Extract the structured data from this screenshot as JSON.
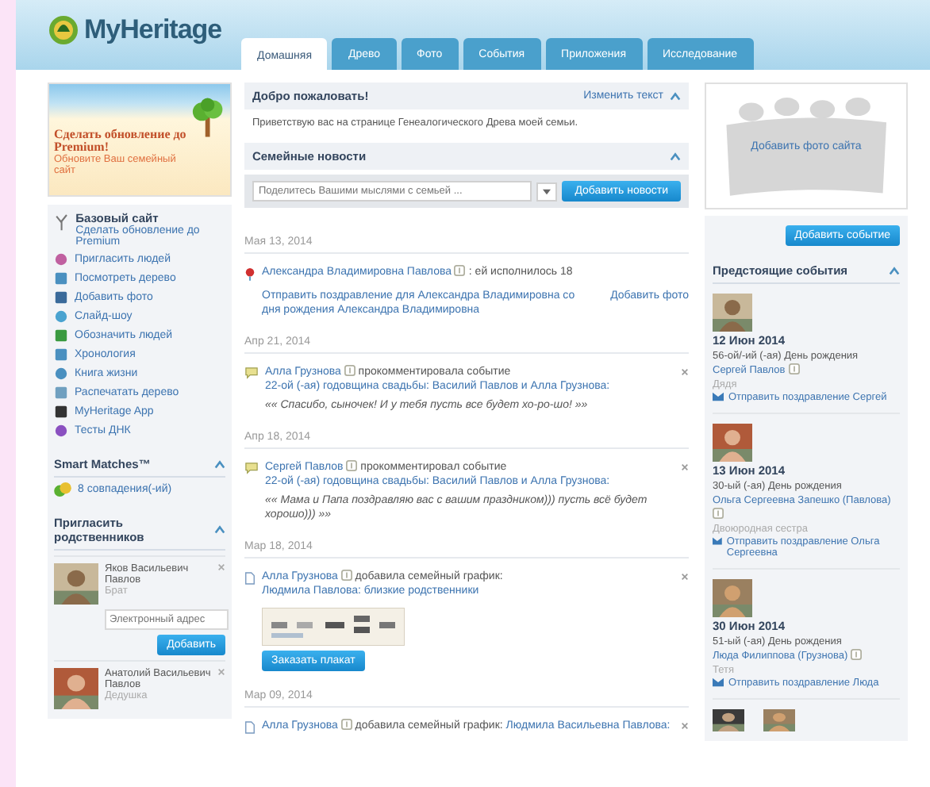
{
  "logo": {
    "text": "MyHeritage"
  },
  "tabs": [
    {
      "label": "Домашняя",
      "selected": true
    },
    {
      "label": "Древо",
      "selected": false
    },
    {
      "label": "Фото",
      "selected": false
    },
    {
      "label": "События",
      "selected": false
    },
    {
      "label": "Приложения",
      "selected": false
    },
    {
      "label": "Исследование",
      "selected": false
    }
  ],
  "sidebar": {
    "promo": {
      "title": "Сделать обновление до Premium!",
      "subtitle": "Обновите Ваш семейный сайт"
    },
    "plan": {
      "title": "Базовый сайт",
      "link": "Сделать обновление до Premium"
    },
    "items": [
      {
        "label": "Пригласить людей"
      },
      {
        "label": "Посмотреть дерево"
      },
      {
        "label": "Добавить фото"
      },
      {
        "label": "Слайд-шоу"
      },
      {
        "label": "Обозначить людей"
      },
      {
        "label": "Хронология"
      },
      {
        "label": "Книга жизни"
      },
      {
        "label": "Распечатать дерево"
      },
      {
        "label": "MyHeritage App"
      },
      {
        "label": "Тесты ДНК"
      }
    ],
    "smart_matches": {
      "title": "Smart Matches™",
      "expanded": true,
      "count": "8 совпадения(-ий)"
    },
    "invite": {
      "title": "Пригласить родственников",
      "expanded": true,
      "people": [
        {
          "name": "Яков Васильевич Павлов",
          "relation": "Брат",
          "email_placeholder": "Электронный адрес",
          "button": "Добавить"
        },
        {
          "name": "Анатолий Васильевич Павлов",
          "relation": "Дедушка"
        }
      ]
    }
  },
  "welcome": {
    "title": "Добро пожаловать!",
    "edit_link": "Изменить текст",
    "expanded": true,
    "text": "Приветствую вас на странице Генеалогического Древа моей семьи."
  },
  "news": {
    "title": "Семейные новости",
    "expanded": true,
    "placeholder": "Поделитесь Вашими мыслями с семьей ...",
    "button": "Добавить новости",
    "groups": [
      {
        "date": "Мая 13, 2014",
        "items": [
          {
            "kind": "birthday",
            "actor": "Александра Владимировна Павлова",
            "action": ": ей исполнилось 18",
            "closable": false,
            "links": [
              "Отправить поздравление для Александра Владимировна со дня рождения Александра Владимировна",
              "Добавить фото"
            ]
          }
        ]
      },
      {
        "date": "Апр 21, 2014",
        "items": [
          {
            "kind": "comment",
            "actor": "Алла Грузнова",
            "action": "прокомментировала событие",
            "target": "22-ой (-ая) годовщина свадьбы: Василий Павлов и Алла Грузнова:",
            "quote": "«« Спасибо, сыночек! И у тебя пусть все будет хо-ро-шо! »»",
            "closable": true
          }
        ]
      },
      {
        "date": "Апр 18, 2014",
        "items": [
          {
            "kind": "comment",
            "actor": "Сергей Павлов",
            "action": "прокомментировал событие",
            "target": "22-ой (-ая) годовщина свадьбы: Василий Павлов и Алла Грузнова:",
            "quote": "«« Мама и Папа поздравляю вас с вашим праздником))) пусть всё будет хорошо))) »»",
            "closable": true
          }
        ]
      },
      {
        "date": "Мар 18, 2014",
        "items": [
          {
            "kind": "chart",
            "actor": "Алла Грузнова",
            "action": "добавила семейный график:",
            "target": "Людмила Павлова: близкие родственники",
            "closable": true,
            "button": "Заказать плакат"
          }
        ]
      },
      {
        "date": "Мар 09, 2014",
        "items": [
          {
            "kind": "chart",
            "actor": "Алла Грузнова",
            "action": "добавила семейный график:",
            "target": "Людмила Васильевна Павлова:",
            "closable": true
          }
        ]
      }
    ]
  },
  "site_photo": {
    "label": "Добавить фото сайта"
  },
  "events": {
    "button": "Добавить событие",
    "title": "Предстоящие события",
    "expanded": true,
    "items": [
      {
        "date": "12 Июн 2014",
        "occasion": "56-ой/-ий (-ая) День рождения",
        "name": "Сергей Павлов",
        "relation": "Дядя",
        "greet": "Отправить поздравление Сергей"
      },
      {
        "date": "13 Июн 2014",
        "occasion": "30-ый (-ая) День рождения",
        "name": "Ольга Сергеевна Запешко (Павлова)",
        "relation": "Двоюродная сестра",
        "greet": "Отправить поздравление Ольга Сергеевна"
      },
      {
        "date": "30 Июн 2014",
        "occasion": "51-ый (-ая) День рождения",
        "name": "Люда Филиппова (Грузнова)",
        "relation": "Тетя",
        "greet": "Отправить поздравление Люда"
      }
    ]
  }
}
